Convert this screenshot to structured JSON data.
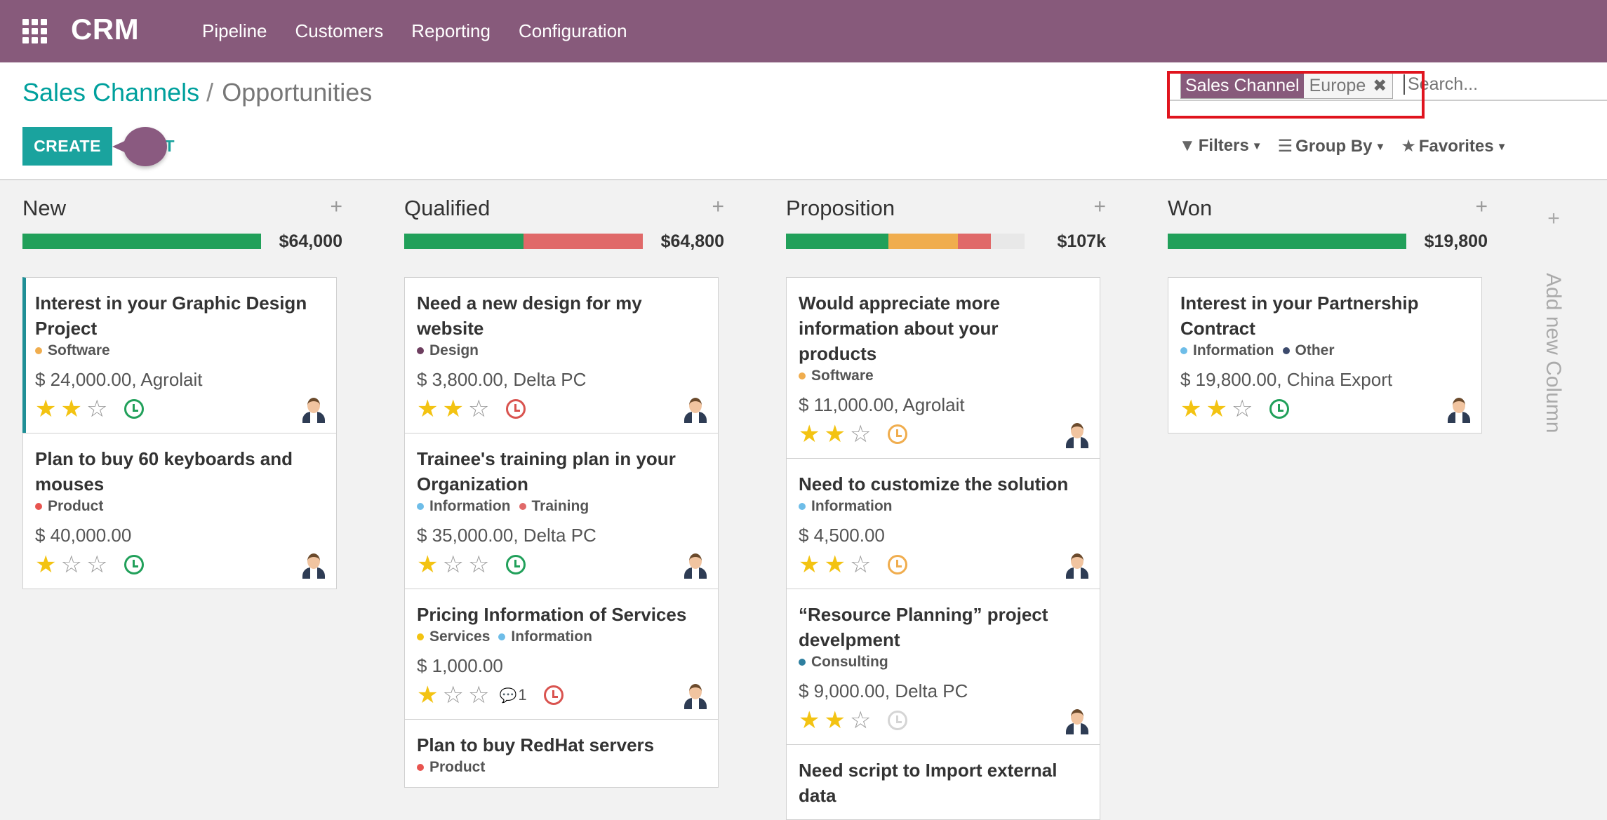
{
  "navbar": {
    "apps_icon": "apps-grid-icon",
    "brand": "CRM",
    "menu": [
      "Pipeline",
      "Customers",
      "Reporting",
      "Configuration"
    ]
  },
  "breadcrumb": {
    "parent": "Sales Channels",
    "separator": "/",
    "current": "Opportunities"
  },
  "buttons": {
    "create": "CREATE",
    "import": "ORT"
  },
  "search": {
    "facet_category": "Sales Channel",
    "facet_value": "Europe",
    "facet_remove": "✖",
    "placeholder": "Search...",
    "filters": "Filters",
    "group_by": "Group By",
    "favorites": "Favorites"
  },
  "colors": {
    "navbar": "#875a7b",
    "primary": "#1aa39e",
    "highlight": "#e0141e"
  },
  "columns": [
    {
      "title": "New",
      "total": "$64,000",
      "progress": [
        {
          "color": "#21a05a",
          "fraction": 1.0
        }
      ],
      "cards": [
        {
          "title": "Interest in your Graphic Design Project",
          "tags": [
            {
              "name": "Software",
              "color": "#f0ad4e"
            }
          ],
          "amount": "$ 24,000.00, Agrolait",
          "stars": 2,
          "activity": "green",
          "accent": true
        },
        {
          "title": "Plan to buy 60 keyboards and mouses",
          "tags": [
            {
              "name": "Product",
              "color": "#e8544f"
            }
          ],
          "amount": "$ 40,000.00",
          "stars": 1,
          "activity": "green"
        }
      ]
    },
    {
      "title": "Qualified",
      "total": "$64,800",
      "progress": [
        {
          "color": "#21a05a",
          "fraction": 0.5
        },
        {
          "color": "#e06969",
          "fraction": 0.5
        }
      ],
      "cards": [
        {
          "title": "Need a new design for my website",
          "tags": [
            {
              "name": "Design",
              "color": "#6d3e5f"
            }
          ],
          "amount": "$ 3,800.00, Delta PC",
          "stars": 2,
          "activity": "red"
        },
        {
          "title": "Trainee's training plan in your Organization",
          "tags": [
            {
              "name": "Information",
              "color": "#6ebde8"
            },
            {
              "name": "Training",
              "color": "#e06969"
            }
          ],
          "amount": "$ 35,000.00, Delta PC",
          "stars": 1,
          "activity": "green"
        },
        {
          "title": "Pricing Information of Services",
          "tags": [
            {
              "name": "Services",
              "color": "#f3c312"
            },
            {
              "name": "Information",
              "color": "#6ebde8"
            }
          ],
          "amount": "$ 1,000.00",
          "stars": 1,
          "messages": "1",
          "activity": "red"
        },
        {
          "title": "Plan to buy RedHat servers",
          "tags": [
            {
              "name": "Product",
              "color": "#e8544f"
            }
          ],
          "amount": "",
          "stars": 0,
          "activity": "none"
        }
      ]
    },
    {
      "title": "Proposition",
      "total": "$107k",
      "progress": [
        {
          "color": "#21a05a",
          "fraction": 0.43
        },
        {
          "color": "#f0ad4e",
          "fraction": 0.29
        },
        {
          "color": "#e06969",
          "fraction": 0.14
        },
        {
          "color": "#e8e8e8",
          "fraction": 0.14
        }
      ],
      "cards": [
        {
          "title": "Would appreciate more information about your products",
          "tags": [
            {
              "name": "Software",
              "color": "#f0ad4e"
            }
          ],
          "amount": "$ 11,000.00, Agrolait",
          "stars": 2,
          "activity": "orange"
        },
        {
          "title": "Need to customize the solution",
          "tags": [
            {
              "name": "Information",
              "color": "#6ebde8"
            }
          ],
          "amount": "$ 4,500.00",
          "stars": 2,
          "activity": "orange"
        },
        {
          "title": "“Resource Planning” project develpment",
          "tags": [
            {
              "name": "Consulting",
              "color": "#2e7f9f"
            }
          ],
          "amount": "$ 9,000.00, Delta PC",
          "stars": 2,
          "activity": "grey"
        },
        {
          "title": "Need script to Import external data",
          "tags": [],
          "amount": "",
          "stars": 0,
          "activity": "none"
        }
      ]
    },
    {
      "title": "Won",
      "total": "$19,800",
      "progress": [
        {
          "color": "#21a05a",
          "fraction": 1.0
        }
      ],
      "cards": [
        {
          "title": "Interest in your Partnership Contract",
          "tags": [
            {
              "name": "Information",
              "color": "#6ebde8"
            },
            {
              "name": "Other",
              "color": "#3c4a6c"
            }
          ],
          "amount": "$ 19,800.00, China Export",
          "stars": 2,
          "activity": "green"
        }
      ]
    }
  ],
  "add_column": {
    "label": "Add new Column",
    "icon": "plus-icon"
  }
}
